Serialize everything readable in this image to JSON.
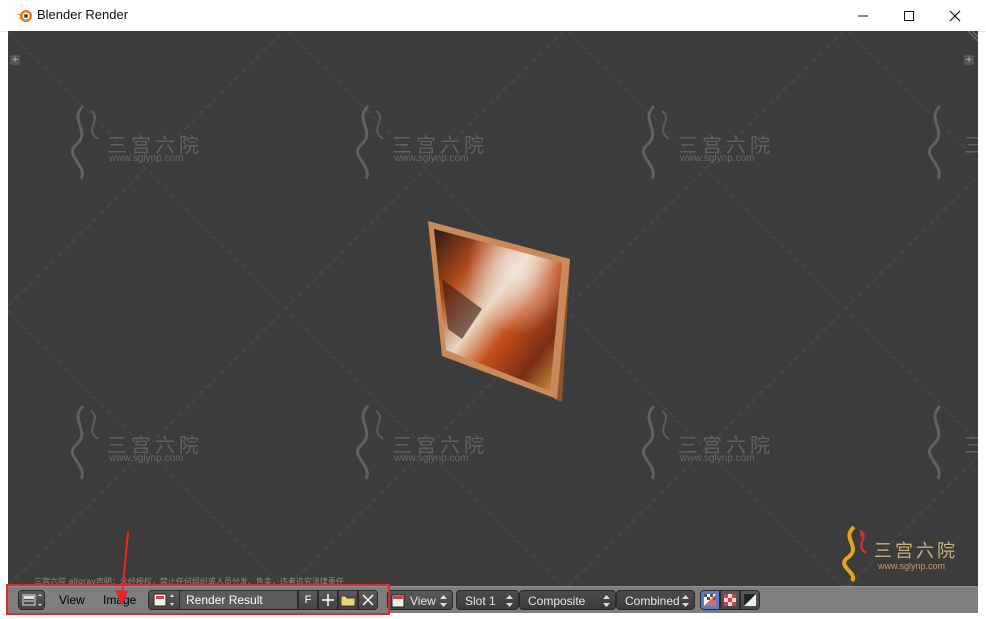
{
  "window": {
    "title": "Blender Render",
    "controls": {
      "minimize": "minimize",
      "maximize": "maximize",
      "close": "close"
    }
  },
  "header": {
    "editor_type_icon": "image-editor-icon",
    "menu": {
      "view": "View",
      "image": "Image"
    },
    "image_block": {
      "browse_icon": "image-browse-icon",
      "name": "Render Result",
      "fake_user": "F",
      "new_icon": "plus-icon",
      "open_icon": "folder-icon",
      "unlink_icon": "x-icon"
    },
    "view_select": "View",
    "slot_select": "Slot 1",
    "layer_select": "Composite",
    "pass_select": "Combined",
    "draw_mode_icons": [
      "color-alpha-icon",
      "checker-icon",
      "z-buffer-icon"
    ]
  },
  "watermark": {
    "site_cn": "三宫六院",
    "site_url": "www.sglynp.com",
    "notice": "三宫六院 allgray声明：未经授权，禁止任何组织或人员分发、售卖，违者追究法律责任"
  },
  "colors": {
    "viewport_bg": "#3c3c3c",
    "header_bg": "#7e7e7e",
    "highlight": "#e8262a",
    "frame": "#c88a5a"
  }
}
